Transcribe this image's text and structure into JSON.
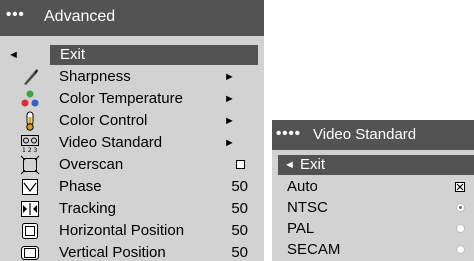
{
  "advanced_menu": {
    "title": "Advanced",
    "dots": "•••",
    "exit_label": "Exit",
    "items": [
      {
        "label": "Sharpness",
        "value": "",
        "control": "submenu",
        "icon": "sharpness-icon"
      },
      {
        "label": "Color Temperature",
        "value": "",
        "control": "submenu",
        "icon": "color-temperature-icon"
      },
      {
        "label": "Color Control",
        "value": "",
        "control": "submenu",
        "icon": "color-control-icon"
      },
      {
        "label": "Video Standard",
        "value": "",
        "control": "submenu",
        "icon": "video-standard-icon"
      },
      {
        "label": "Overscan",
        "value": "",
        "control": "checkbox",
        "checked": false,
        "icon": "overscan-icon"
      },
      {
        "label": "Phase",
        "value": "50",
        "control": "value",
        "icon": "phase-icon"
      },
      {
        "label": "Tracking",
        "value": "50",
        "control": "value",
        "icon": "tracking-icon"
      },
      {
        "label": "Horizontal Position",
        "value": "50",
        "control": "value",
        "icon": "horizontal-position-icon"
      },
      {
        "label": "Vertical Position",
        "value": "50",
        "control": "value",
        "icon": "vertical-position-icon"
      }
    ]
  },
  "video_standard_menu": {
    "title": "Video Standard",
    "dots": "••••",
    "exit_label": "Exit",
    "options": [
      {
        "label": "Auto",
        "control": "checkbox",
        "checked": true
      },
      {
        "label": "NTSC",
        "control": "radio",
        "selected": true
      },
      {
        "label": "PAL",
        "control": "radio",
        "selected": false
      },
      {
        "label": "SECAM",
        "control": "radio",
        "selected": false
      }
    ]
  },
  "colors": {
    "menu_background": "#d2d2d2",
    "title_bar": "#535353",
    "highlight": "#535353",
    "text": "#000000",
    "title_text": "#ffffff"
  }
}
